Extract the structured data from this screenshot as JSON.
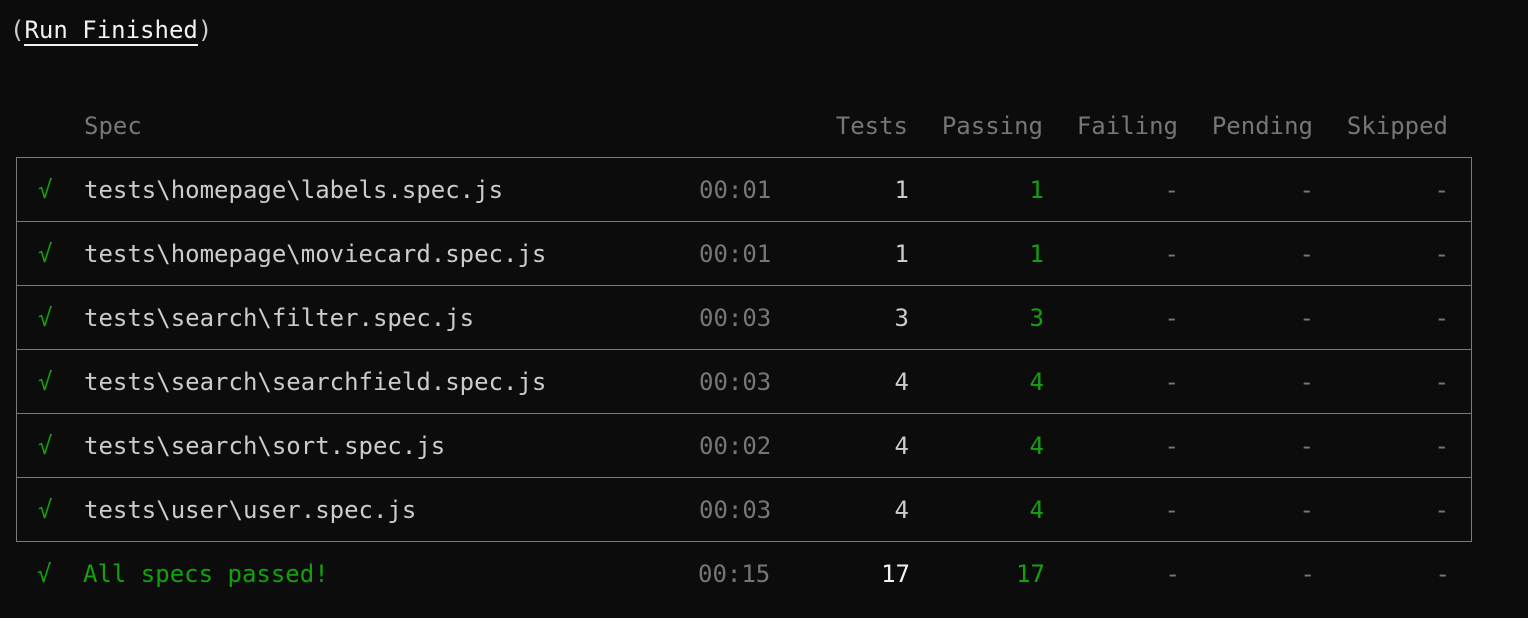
{
  "title": {
    "open_paren": "(",
    "text": "Run Finished",
    "close_paren": ")"
  },
  "header": {
    "spec": "Spec",
    "tests": "Tests",
    "passing": "Passing",
    "failing": "Failing",
    "pending": "Pending",
    "skipped": "Skipped"
  },
  "rows": [
    {
      "status": "√",
      "spec": "tests\\homepage\\labels.spec.js",
      "duration": "00:01",
      "tests": "1",
      "passing": "1",
      "failing": "-",
      "pending": "-",
      "skipped": "-"
    },
    {
      "status": "√",
      "spec": "tests\\homepage\\moviecard.spec.js",
      "duration": "00:01",
      "tests": "1",
      "passing": "1",
      "failing": "-",
      "pending": "-",
      "skipped": "-"
    },
    {
      "status": "√",
      "spec": "tests\\search\\filter.spec.js",
      "duration": "00:03",
      "tests": "3",
      "passing": "3",
      "failing": "-",
      "pending": "-",
      "skipped": "-"
    },
    {
      "status": "√",
      "spec": "tests\\search\\searchfield.spec.js",
      "duration": "00:03",
      "tests": "4",
      "passing": "4",
      "failing": "-",
      "pending": "-",
      "skipped": "-"
    },
    {
      "status": "√",
      "spec": "tests\\search\\sort.spec.js",
      "duration": "00:02",
      "tests": "4",
      "passing": "4",
      "failing": "-",
      "pending": "-",
      "skipped": "-"
    },
    {
      "status": "√",
      "spec": "tests\\user\\user.spec.js",
      "duration": "00:03",
      "tests": "4",
      "passing": "4",
      "failing": "-",
      "pending": "-",
      "skipped": "-"
    }
  ],
  "summary": {
    "status": "√",
    "text": "All specs passed!",
    "duration": "00:15",
    "tests": "17",
    "passing": "17",
    "failing": "-",
    "pending": "-",
    "skipped": "-"
  },
  "colors": {
    "background": "#0c0c0c",
    "foreground": "#cccccc",
    "success": "#13a10e",
    "muted": "#767676",
    "border": "#7a7a7a"
  }
}
